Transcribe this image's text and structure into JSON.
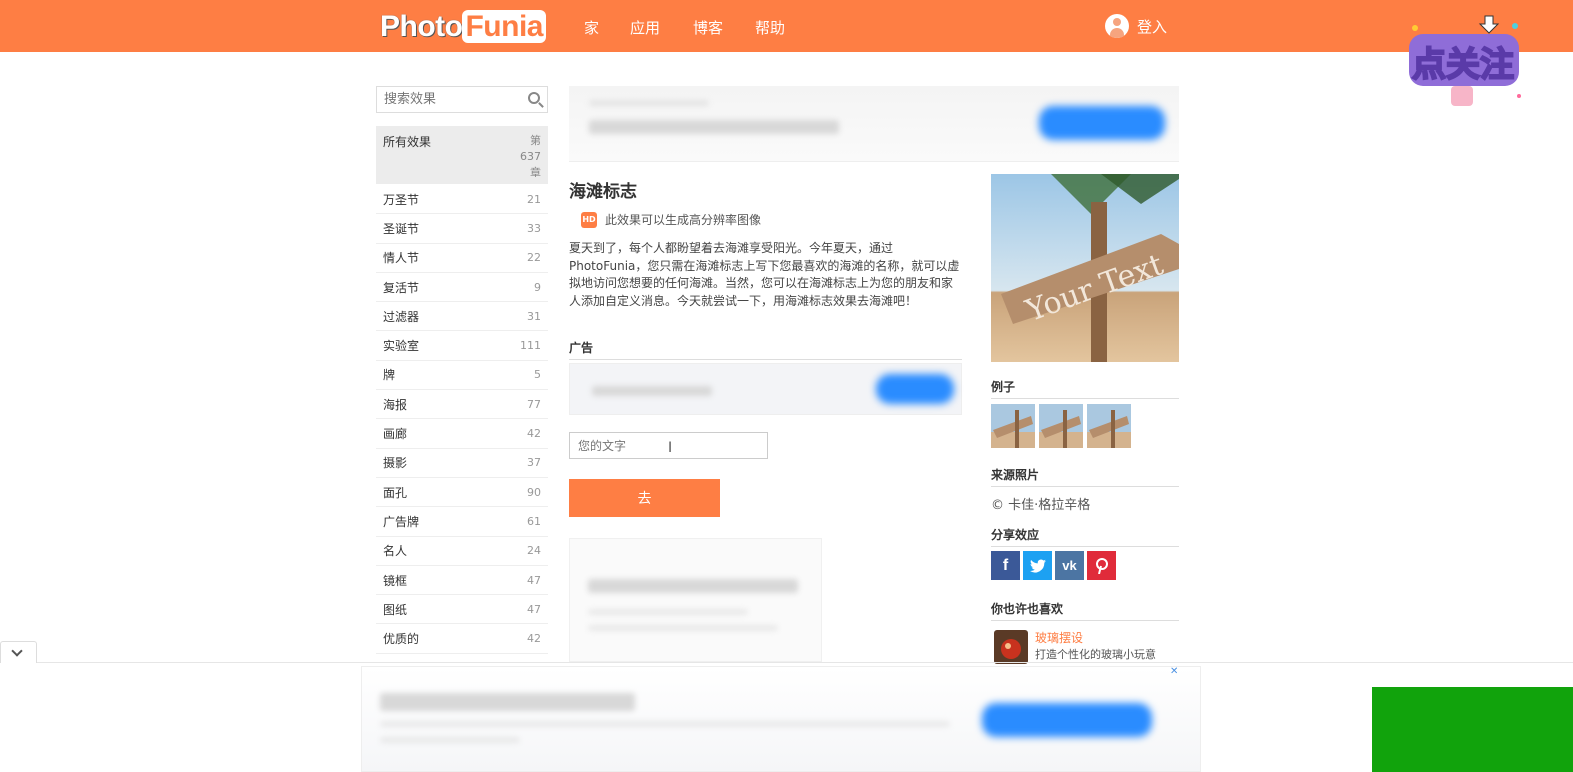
{
  "header": {
    "logo_part1": "Photo",
    "logo_part2": "Funia",
    "nav": [
      "家",
      "应用",
      "博客",
      "帮助"
    ],
    "login": "登入",
    "brand_color": "#fe7e44"
  },
  "sidebar": {
    "search_placeholder": "搜索效果",
    "all_label": "所有效果",
    "all_count": "第 637 章",
    "categories": [
      {
        "name": "万圣节",
        "count": "21"
      },
      {
        "name": "圣诞节",
        "count": "33"
      },
      {
        "name": "情人节",
        "count": "22"
      },
      {
        "name": "复活节",
        "count": "9"
      },
      {
        "name": "过滤器",
        "count": "31"
      },
      {
        "name": "实验室",
        "count": "111"
      },
      {
        "name": "牌",
        "count": "5"
      },
      {
        "name": "海报",
        "count": "77"
      },
      {
        "name": "画廊",
        "count": "42"
      },
      {
        "name": "摄影",
        "count": "37"
      },
      {
        "name": "面孔",
        "count": "90"
      },
      {
        "name": "广告牌",
        "count": "61"
      },
      {
        "name": "名人",
        "count": "24"
      },
      {
        "name": "镜框",
        "count": "47"
      },
      {
        "name": "图纸",
        "count": "47"
      },
      {
        "name": "优质的",
        "count": "42"
      }
    ]
  },
  "main": {
    "title": "海滩标志",
    "hd_badge": "HD",
    "hd_text": "此效果可以生成高分辨率图像",
    "description": "夏天到了，每个人都盼望着去海滩享受阳光。今年夏天，通过PhotoFunia，您只需在海滩标志上写下您最喜欢的海滩的名称，就可以虚拟地访问您想要的任何海滩。当然，您可以在海滩标志上为您的朋友和家人添加自定义消息。今天就尝试一下，用海滩标志效果去海滩吧！",
    "ad_label": "广告",
    "text_placeholder": "您的文字",
    "go_label": "去"
  },
  "right": {
    "preview_text": "Your Text",
    "examples_label": "例子",
    "source_label": "来源照片",
    "source_credit": "© 卡佳·格拉辛格",
    "share_label": "分享效应",
    "share_icons": [
      "facebook-icon",
      "twitter-icon",
      "vk-icon",
      "pinterest-icon"
    ],
    "share_colors": [
      "#3b5998",
      "#1da1f2",
      "#4c75a3",
      "#e02b3a"
    ],
    "like_label": "你也许也喜欢",
    "like_title": "玻璃摆设",
    "like_sub": "打造个性化的玻璃小玩意"
  },
  "overlay": {
    "sticker_text": "点关注"
  }
}
